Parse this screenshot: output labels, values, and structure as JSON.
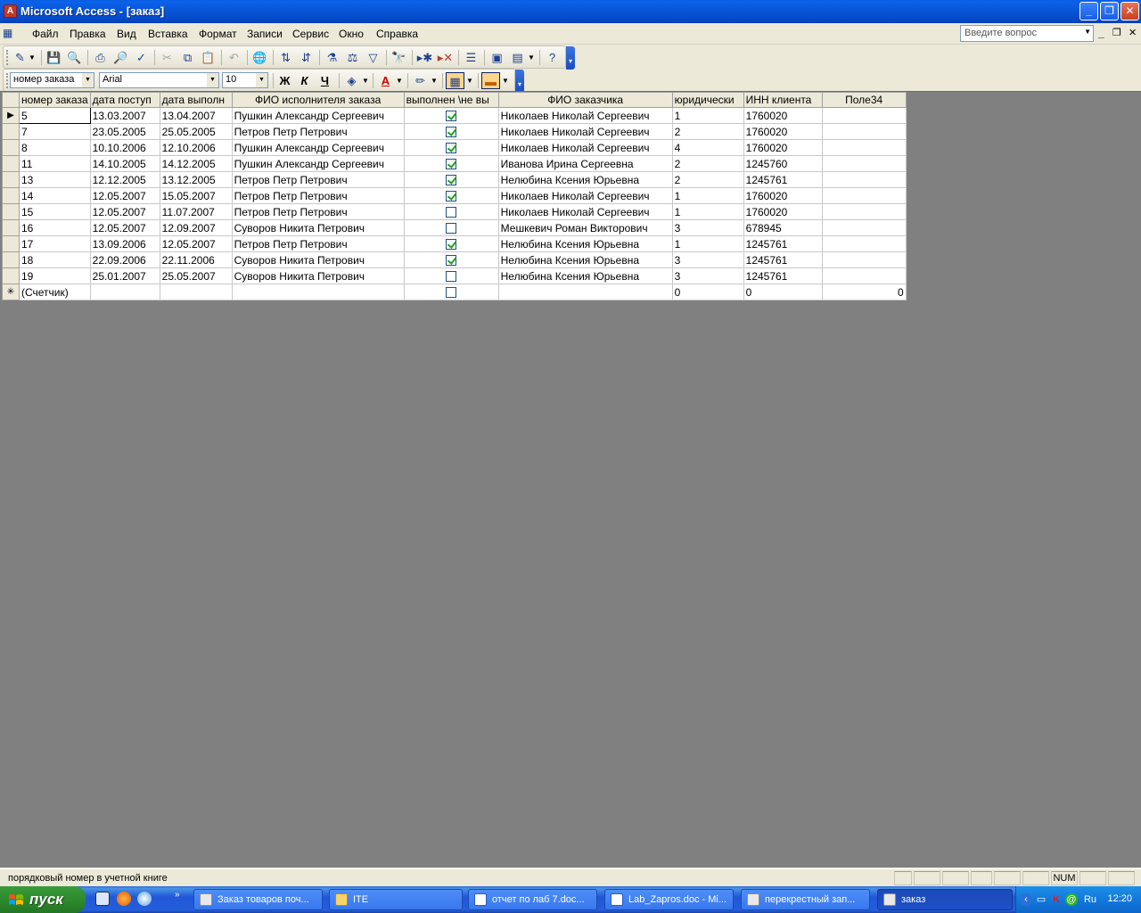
{
  "window": {
    "title": "Microsoft Access - [заказ]",
    "minimize": "_",
    "maximize": "❐",
    "close": "✕"
  },
  "menu": {
    "items": [
      "Файл",
      "Правка",
      "Вид",
      "Вставка",
      "Формат",
      "Записи",
      "Сервис",
      "Окно",
      "Справка"
    ],
    "ask_placeholder": "Введите вопрос",
    "mdi_minimize": "_",
    "mdi_restore": "❐",
    "mdi_close": "✕"
  },
  "format_toolbar": {
    "field_combo": "номер заказа",
    "font_combo": "Arial",
    "size_combo": "10",
    "bold": "Ж",
    "italic": "К",
    "underline": "Ч"
  },
  "grid": {
    "columns": [
      "номер заказа",
      "дата поступ",
      "дата выполн",
      "ФИО исполнителя заказа",
      "выполнен \\не вы",
      "ФИО заказчика",
      "юридически",
      "ИНН клиента",
      "Поле34"
    ],
    "rows": [
      {
        "num": "5",
        "d1": "13.03.2007",
        "d2": "13.04.2007",
        "exec": "Пушкин Александр Сергеевич",
        "done": true,
        "cust": "Николаев Николай Сергеевич",
        "jur": "1",
        "inn": "1760020",
        "f34": ""
      },
      {
        "num": "7",
        "d1": "23.05.2005",
        "d2": "25.05.2005",
        "exec": "Петров Петр Петрович",
        "done": true,
        "cust": "Николаев Николай Сергеевич",
        "jur": "2",
        "inn": "1760020",
        "f34": ""
      },
      {
        "num": "8",
        "d1": "10.10.2006",
        "d2": "12.10.2006",
        "exec": "Пушкин Александр Сергеевич",
        "done": true,
        "cust": "Николаев Николай Сергеевич",
        "jur": "4",
        "inn": "1760020",
        "f34": ""
      },
      {
        "num": "11",
        "d1": "14.10.2005",
        "d2": "14.12.2005",
        "exec": "Пушкин Александр Сергеевич",
        "done": true,
        "cust": "Иванова Ирина Сергеевна",
        "jur": "2",
        "inn": "1245760",
        "f34": ""
      },
      {
        "num": "13",
        "d1": "12.12.2005",
        "d2": "13.12.2005",
        "exec": "Петров Петр Петрович",
        "done": true,
        "cust": "Нелюбина Ксения Юрьевна",
        "jur": "2",
        "inn": "1245761",
        "f34": ""
      },
      {
        "num": "14",
        "d1": "12.05.2007",
        "d2": "15.05.2007",
        "exec": "Петров Петр Петрович",
        "done": true,
        "cust": "Николаев Николай Сергеевич",
        "jur": "1",
        "inn": "1760020",
        "f34": ""
      },
      {
        "num": "15",
        "d1": "12.05.2007",
        "d2": "11.07.2007",
        "exec": "Петров Петр Петрович",
        "done": false,
        "cust": "Николаев Николай Сергеевич",
        "jur": "1",
        "inn": "1760020",
        "f34": ""
      },
      {
        "num": "16",
        "d1": "12.05.2007",
        "d2": "12.09.2007",
        "exec": "Суворов Никита Петрович",
        "done": false,
        "cust": "Мешкевич Роман Викторович",
        "jur": "3",
        "inn": "678945",
        "f34": ""
      },
      {
        "num": "17",
        "d1": "13.09.2006",
        "d2": "12.05.2007",
        "exec": "Петров Петр Петрович",
        "done": true,
        "cust": "Нелюбина Ксения Юрьевна",
        "jur": "1",
        "inn": "1245761",
        "f34": ""
      },
      {
        "num": "18",
        "d1": "22.09.2006",
        "d2": "22.11.2006",
        "exec": "Суворов Никита Петрович",
        "done": true,
        "cust": "Нелюбина Ксения Юрьевна",
        "jur": "3",
        "inn": "1245761",
        "f34": ""
      },
      {
        "num": "19",
        "d1": "25.01.2007",
        "d2": "25.05.2007",
        "exec": "Суворов Никита Петрович",
        "done": false,
        "cust": "Нелюбина Ксения Юрьевна",
        "jur": "3",
        "inn": "1245761",
        "f34": ""
      }
    ],
    "new_row": {
      "marker": "✳",
      "num": "(Счетчик)",
      "jur": "0",
      "inn": "0",
      "f34": "0"
    },
    "current_marker": "▶"
  },
  "status": {
    "text": "порядковый номер в учетной книге",
    "num": "NUM"
  },
  "taskbar": {
    "start": "пуск",
    "tasks": [
      {
        "label": "Заказ товаров поч...",
        "icon": "access-form-icon"
      },
      {
        "label": "ITE",
        "icon": "folder-icon"
      },
      {
        "label": "отчет по лаб 7.doc...",
        "icon": "word-doc-icon"
      },
      {
        "label": "Lab_Zapros.doc - Mi...",
        "icon": "word-doc-icon"
      },
      {
        "label": "перекрестный зап...",
        "icon": "access-query-icon"
      },
      {
        "label": "заказ",
        "icon": "access-table-icon"
      }
    ],
    "lang": "Ru",
    "clock": "12:20"
  },
  "colors": {
    "title_bar": "#0754d6",
    "workspace": "#808080",
    "start_green": "#2d8a2d",
    "check_green": "#21a121"
  }
}
